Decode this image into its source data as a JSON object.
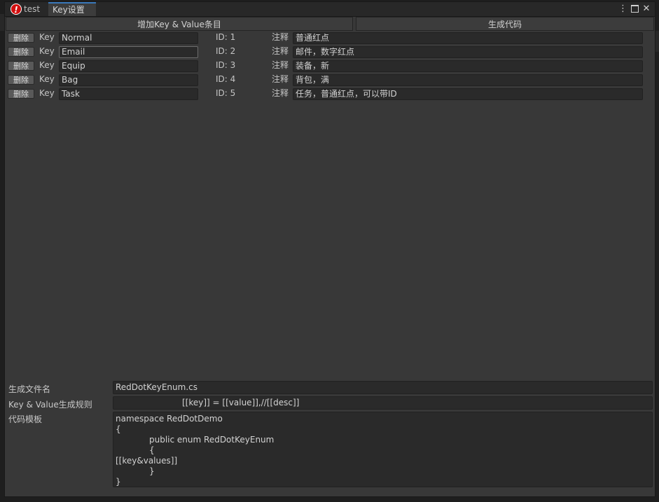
{
  "window": {
    "tabs": [
      {
        "label": "test"
      },
      {
        "label": "Key设置"
      }
    ]
  },
  "toolbar": {
    "add_label": "增加Key & Value条目",
    "gen_label": "生成代码"
  },
  "entries": [
    {
      "delete_label": "删除",
      "key_label": "Key",
      "key": "Normal",
      "id": "ID: 1",
      "note_label": "注释",
      "note": "普通红点"
    },
    {
      "delete_label": "删除",
      "key_label": "Key",
      "key": "Email",
      "id": "ID: 2",
      "note_label": "注释",
      "note": "邮件，数字红点"
    },
    {
      "delete_label": "删除",
      "key_label": "Key",
      "key": "Equip",
      "id": "ID: 3",
      "note_label": "注释",
      "note": "装备，新"
    },
    {
      "delete_label": "删除",
      "key_label": "Key",
      "key": "Bag",
      "id": "ID: 4",
      "note_label": "注释",
      "note": "背包，满"
    },
    {
      "delete_label": "删除",
      "key_label": "Key",
      "key": "Task",
      "id": "ID: 5",
      "note_label": "注释",
      "note": "任务，普通红点，可以带ID"
    }
  ],
  "settings": {
    "file_name_label": "生成文件名",
    "file_name": "RedDotKeyEnum.cs",
    "rule_label": "Key & Value生成规则",
    "rule": "[[key]] = [[value]],//[[desc]]",
    "template_label": "代码模板",
    "template_lines": [
      "namespace RedDotDemo",
      "{",
      "public enum RedDotKeyEnum",
      "{",
      "[[key&values]]",
      "}",
      "}"
    ]
  },
  "icons": {
    "logo": "app-logo-icon",
    "menu": "kebab-menu-icon",
    "maximize": "maximize-icon",
    "close": "close-icon"
  },
  "colors": {
    "background": "#383838",
    "field": "#2a2a2a",
    "active_tab_accent": "#3a79bb",
    "logo_red": "#d10f0f"
  }
}
